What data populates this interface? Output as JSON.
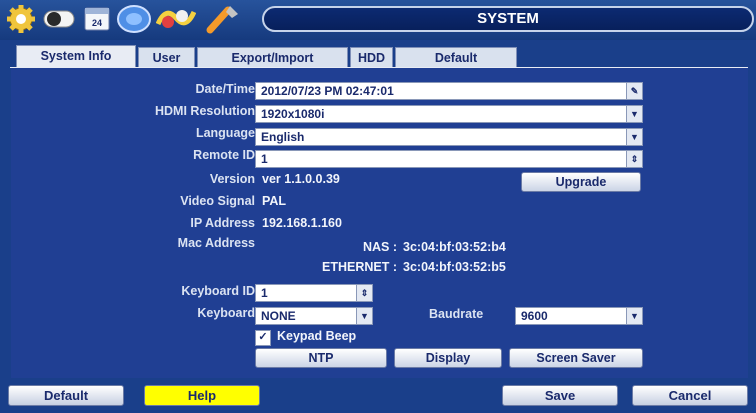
{
  "window": {
    "title": "SYSTEM"
  },
  "toolbar_icons": [
    "gear-icon",
    "toggle-icon",
    "calendar-icon",
    "disc-icon",
    "wave-icon",
    "tools-icon"
  ],
  "calendar_icon_text": "24",
  "tabs": [
    {
      "label": "System Info",
      "active": true
    },
    {
      "label": "User"
    },
    {
      "label": "Export/Import"
    },
    {
      "label": "HDD"
    },
    {
      "label": "Default"
    }
  ],
  "system_info": {
    "datetime": {
      "label": "Date/Time",
      "value": "2012/07/23 PM 02:47:01"
    },
    "hdmi": {
      "label": "HDMI Resolution",
      "value": "1920x1080i"
    },
    "language": {
      "label": "Language",
      "value": "English"
    },
    "remote_id": {
      "label": "Remote ID",
      "value": "1"
    },
    "version": {
      "label": "Version",
      "value": "ver 1.1.0.0.39"
    },
    "upgrade_label": "Upgrade",
    "video_signal": {
      "label": "Video Signal",
      "value": "PAL"
    },
    "ip": {
      "label": "IP Address",
      "value": "192.168.1.160"
    },
    "mac": {
      "label": "Mac Address",
      "nas_label": "NAS :",
      "nas_value": "3c:04:bf:03:52:b4",
      "eth_label": "ETHERNET :",
      "eth_value": "3c:04:bf:03:52:b5"
    },
    "keyboard_id": {
      "label": "Keyboard ID",
      "value": "1"
    },
    "keyboard": {
      "label": "Keyboard",
      "value": "NONE"
    },
    "baudrate": {
      "label": "Baudrate",
      "value": "9600"
    },
    "keypad_beep": {
      "label": "Keypad Beep",
      "checked": true
    },
    "buttons": {
      "ntp": "NTP",
      "display": "Display",
      "screen_saver": "Screen Saver"
    }
  },
  "footer": {
    "default": "Default",
    "help": "Help",
    "save": "Save",
    "cancel": "Cancel"
  },
  "colors": {
    "background": "#1a3f8a",
    "panel": "#203f93",
    "help_button": "#ffff00",
    "title_pill": "#0c2a72"
  }
}
